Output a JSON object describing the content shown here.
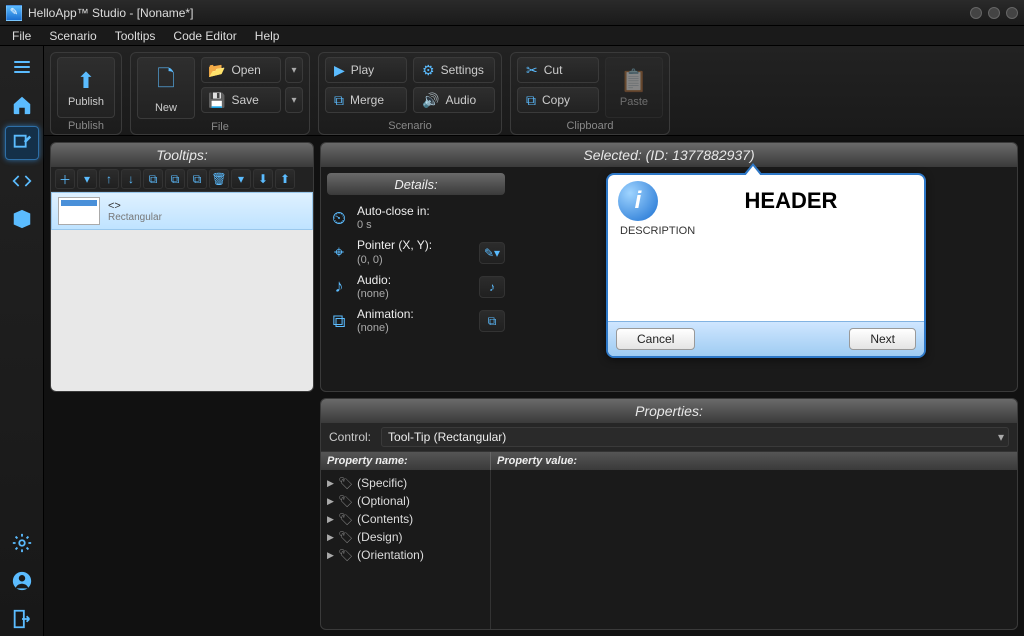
{
  "titlebar": {
    "app_title": "HelloApp™ Studio - [Noname*]"
  },
  "menubar": {
    "items": [
      "File",
      "Scenario",
      "Tooltips",
      "Code Editor",
      "Help"
    ]
  },
  "ribbon": {
    "groups": {
      "publish": {
        "label": "Publish",
        "publish_btn": "Publish"
      },
      "file": {
        "label": "File",
        "new_btn": "New",
        "open_btn": "Open",
        "save_btn": "Save"
      },
      "scenario": {
        "label": "Scenario",
        "play_btn": "Play",
        "merge_btn": "Merge",
        "settings_btn": "Settings",
        "audio_btn": "Audio"
      },
      "clipboard": {
        "label": "Clipboard",
        "cut_btn": "Cut",
        "copy_btn": "Copy",
        "paste_btn": "Paste"
      }
    }
  },
  "tooltips_panel": {
    "title": "Tooltips:",
    "item": {
      "code": "<>",
      "shape": "Rectangular"
    }
  },
  "selected_panel": {
    "title": "Selected:  (ID: 1377882937)",
    "details": {
      "header": "Details:",
      "auto_close": {
        "label": "Auto-close in:",
        "value": "0 s"
      },
      "pointer": {
        "label": "Pointer (X, Y):",
        "value": "(0, 0)"
      },
      "audio": {
        "label": "Audio:",
        "value": "(none)"
      },
      "animation": {
        "label": "Animation:",
        "value": "(none)"
      }
    },
    "preview": {
      "header_text": "HEADER",
      "description": "DESCRIPTION",
      "cancel": "Cancel",
      "next": "Next"
    }
  },
  "properties_panel": {
    "title": "Properties:",
    "control_label": "Control:",
    "control_value": "Tool-Tip (Rectangular)",
    "col_name": "Property name:",
    "col_value": "Property value:",
    "nodes": [
      "(Specific)",
      "(Optional)",
      "(Contents)",
      "(Design)",
      "(Orientation)"
    ]
  }
}
